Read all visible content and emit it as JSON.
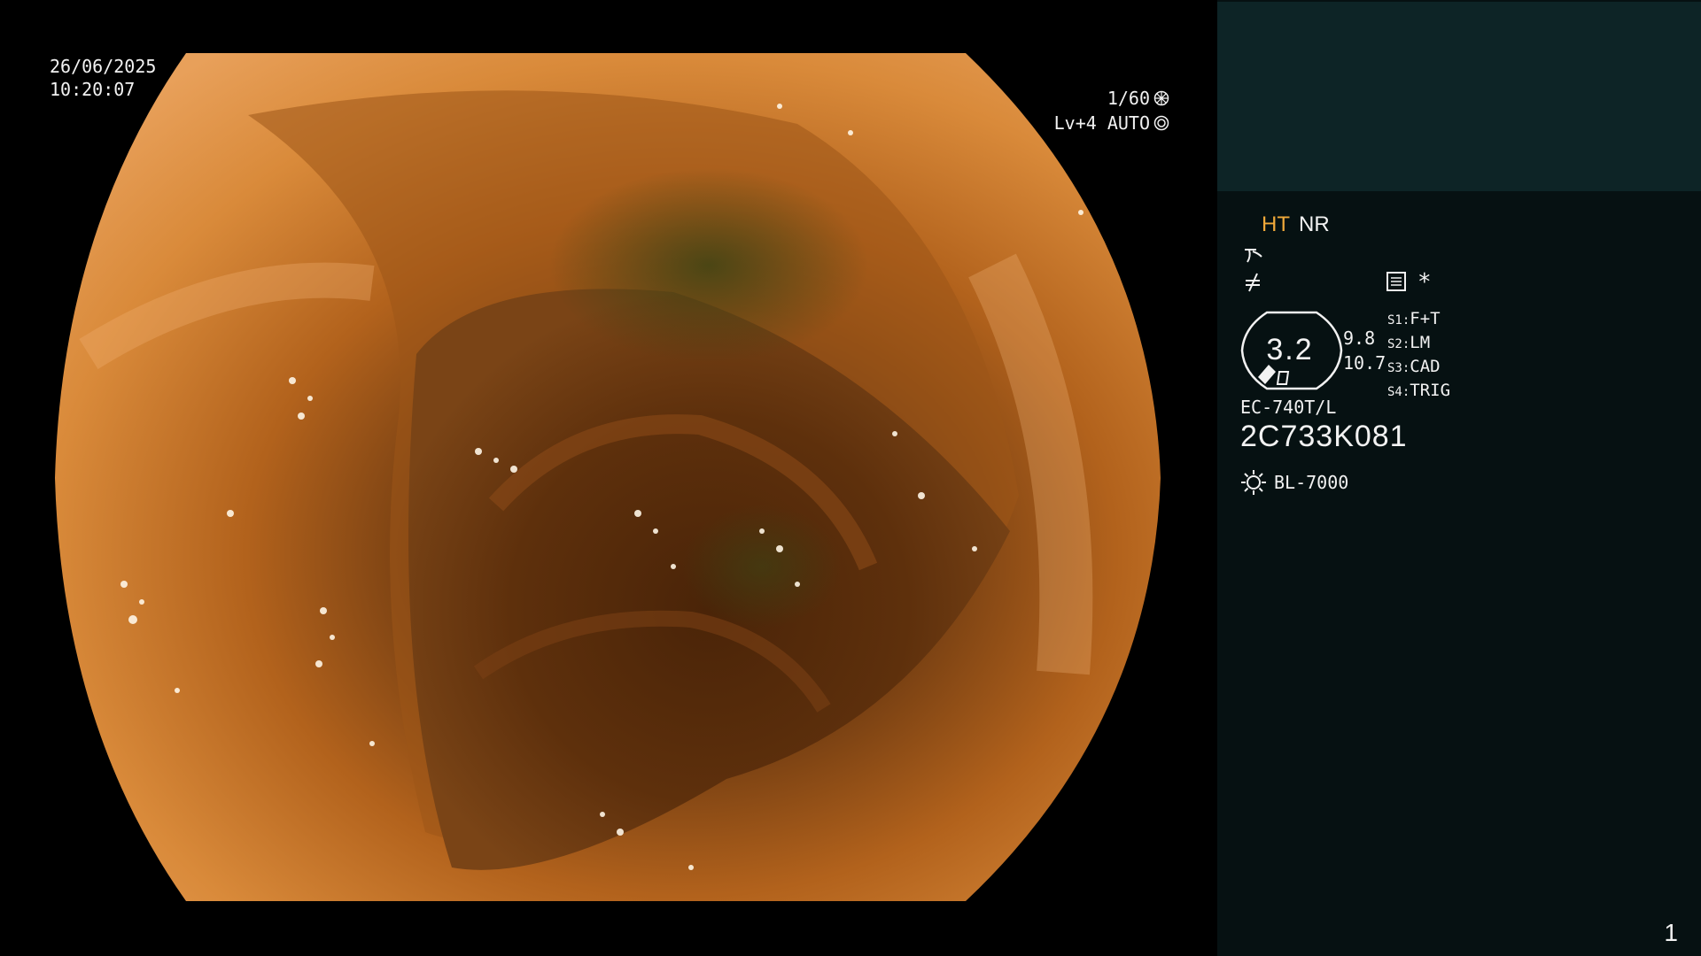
{
  "overlay": {
    "date": "26/06/2025",
    "time": "10:20:07",
    "shutter": "1/60",
    "level": "Lv+4 AUTO"
  },
  "panel": {
    "ht": "HT",
    "nr": "NR",
    "star": "*",
    "zoom_value": "3.2",
    "zoom_a": "9.8",
    "zoom_b": "10.7",
    "slots": [
      {
        "key": "S1:",
        "value": "F+T"
      },
      {
        "key": "S2:",
        "value": "LM"
      },
      {
        "key": "S3:",
        "value": "CAD"
      },
      {
        "key": "S4:",
        "value": "TRIG"
      }
    ],
    "model": "EC-740T/L",
    "serial": "2C733K081",
    "light": "BL-7000",
    "page": "1",
    "colors": {
      "ht_active": "#f0a93a",
      "panel_bg": "#061112",
      "panel_top": "#0d2426"
    },
    "icons": [
      "wave-icon",
      "filter-icon",
      "settings-icon",
      "light-source-icon",
      "aperture-icon",
      "auto-iris-icon"
    ]
  }
}
